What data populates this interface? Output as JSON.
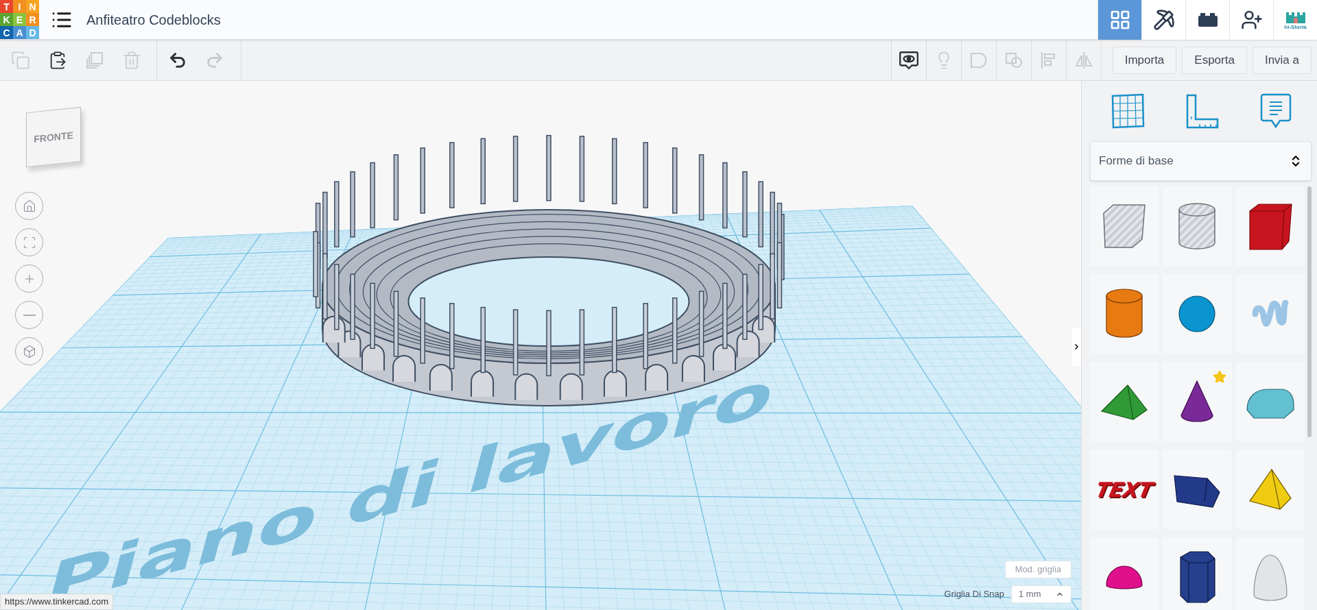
{
  "logo": {
    "letters": [
      "T",
      "I",
      "N",
      "K",
      "E",
      "R",
      "C",
      "A",
      "D"
    ]
  },
  "title": "Anfiteatro Codeblocks",
  "nav": [
    {
      "kind": "grid",
      "selected": true
    },
    {
      "kind": "pickaxe",
      "selected": false
    },
    {
      "kind": "brick",
      "selected": false
    },
    {
      "kind": "add-user",
      "selected": false
    },
    {
      "kind": "avatar",
      "label": "hi-Storia",
      "selected": false
    }
  ],
  "toolbar_left": [
    {
      "kind": "copy",
      "disabled": true
    },
    {
      "kind": "paste",
      "disabled": false
    },
    {
      "kind": "duplicate",
      "disabled": true
    },
    {
      "kind": "delete",
      "disabled": true
    },
    {
      "kind": "undo",
      "disabled": false
    },
    {
      "kind": "redo",
      "disabled": true
    }
  ],
  "toolbar_right": [
    {
      "kind": "notes",
      "disabled": false
    },
    {
      "kind": "bulb",
      "disabled": true
    },
    {
      "kind": "solid",
      "disabled": true
    },
    {
      "kind": "hole",
      "disabled": true
    },
    {
      "kind": "align",
      "disabled": true
    },
    {
      "kind": "mirror",
      "disabled": true
    }
  ],
  "actions": [
    "Importa",
    "Esporta",
    "Invia a"
  ],
  "view_cube": {
    "front": "FRONTE"
  },
  "view_controls": [
    {
      "kind": "home"
    },
    {
      "kind": "fit"
    },
    {
      "kind": "zoom-in"
    },
    {
      "kind": "zoom-out"
    },
    {
      "kind": "ortho"
    }
  ],
  "workplane": {
    "label": "Piano di lavoro"
  },
  "grid_settings": {
    "edit_button": "Mod. griglia",
    "snap_label": "Griglia Di Snap",
    "snap_value": "1 mm"
  },
  "status_url": "https://www.tinkercad.com",
  "panel": {
    "tools": [
      {
        "kind": "workplane"
      },
      {
        "kind": "ruler"
      },
      {
        "kind": "notes"
      }
    ],
    "category": "Forme di base",
    "shapes": [
      {
        "kind": "box-hole",
        "color": "#c8ccd4",
        "favorite": false
      },
      {
        "kind": "cylinder-hole",
        "color": "#c8ccd4",
        "favorite": false
      },
      {
        "kind": "box",
        "color": "#c8141e",
        "favorite": false
      },
      {
        "kind": "cylinder",
        "color": "#e87a12",
        "favorite": false
      },
      {
        "kind": "sphere",
        "color": "#0a94d0",
        "favorite": false
      },
      {
        "kind": "scribble",
        "color": "#9cc4e4",
        "favorite": false
      },
      {
        "kind": "roof",
        "color": "#2f9a36",
        "favorite": false
      },
      {
        "kind": "cone",
        "color": "#7a2a98",
        "favorite": true
      },
      {
        "kind": "round-roof",
        "color": "#62c0d0",
        "favorite": false
      },
      {
        "kind": "text",
        "color": "#c8141e",
        "label": "TEXT",
        "favorite": false
      },
      {
        "kind": "wedge",
        "color": "#233a8a",
        "favorite": false
      },
      {
        "kind": "pyramid",
        "color": "#efcc10",
        "favorite": false
      },
      {
        "kind": "half-sphere",
        "color": "#e0108c",
        "favorite": false
      },
      {
        "kind": "polygon",
        "color": "#26408e",
        "favorite": false
      },
      {
        "kind": "paraboloid",
        "color": "#e2e4e6",
        "favorite": false
      }
    ]
  }
}
